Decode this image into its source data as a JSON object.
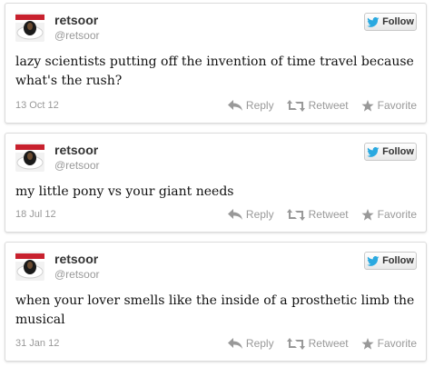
{
  "tweets": [
    {
      "name": "retsoor",
      "handle": "@retsoor",
      "follow_label": "Follow",
      "text": "lazy scientists putting off the invention of time travel because what's the rush?",
      "date": "13 Oct 12",
      "reply_label": "Reply",
      "retweet_label": "Retweet",
      "favorite_label": "Favorite"
    },
    {
      "name": "retsoor",
      "handle": "@retsoor",
      "follow_label": "Follow",
      "text": "my little pony vs your giant needs",
      "date": "18 Jul 12",
      "reply_label": "Reply",
      "retweet_label": "Retweet",
      "favorite_label": "Favorite"
    },
    {
      "name": "retsoor",
      "handle": "@retsoor",
      "follow_label": "Follow",
      "text": "when your lover smells like the inside of a prosthetic limb the musical",
      "date": "31 Jan 12",
      "reply_label": "Reply",
      "retweet_label": "Retweet",
      "favorite_label": "Favorite"
    }
  ],
  "colors": {
    "twitter_blue": "#2aa9e0",
    "meta_gray": "#999999",
    "card_border": "#dcdcdc"
  },
  "icons": [
    "bird-icon",
    "reply-icon",
    "retweet-icon",
    "favorite-icon",
    "avatar"
  ]
}
